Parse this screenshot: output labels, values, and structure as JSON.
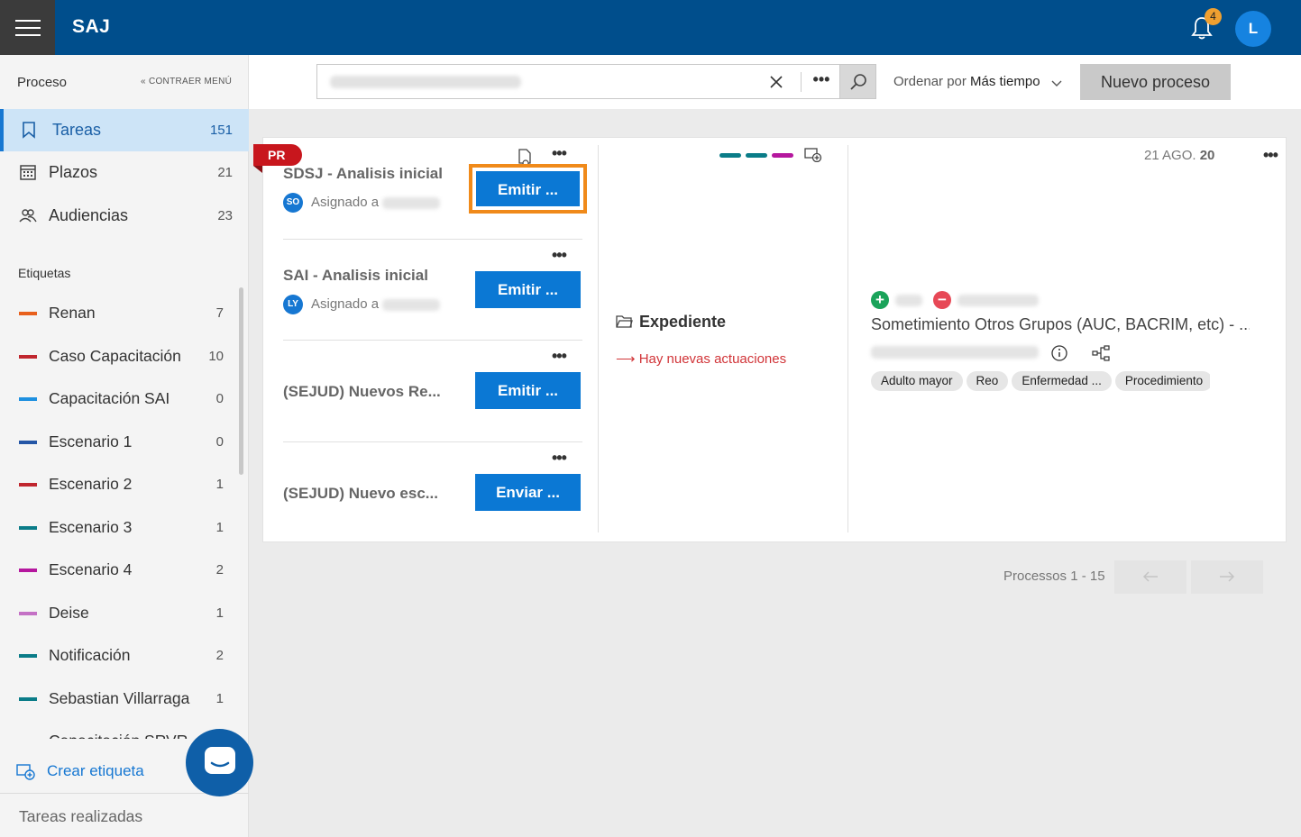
{
  "app": {
    "title": "SAJ",
    "notifications_count": "4",
    "user_initial": "L"
  },
  "sidebar": {
    "header": "Proceso",
    "collapse_label": "CONTRAER MENÚ",
    "nav": [
      {
        "label": "Tareas",
        "count": "151",
        "icon": "bookmark-icon"
      },
      {
        "label": "Plazos",
        "count": "21",
        "icon": "calendar-icon"
      },
      {
        "label": "Audiencias",
        "count": "23",
        "icon": "people-icon"
      }
    ],
    "tags_header": "Etiquetas",
    "tags": [
      {
        "label": "Renan",
        "count": "7",
        "color": "#e8601c"
      },
      {
        "label": "Caso Capacitación",
        "count": "10",
        "color": "#c0262e"
      },
      {
        "label": "Capacitación SAI",
        "count": "0",
        "color": "#1e90e0"
      },
      {
        "label": "Escenario 1",
        "count": "0",
        "color": "#2456a6"
      },
      {
        "label": "Escenario 2",
        "count": "1",
        "color": "#c0262e"
      },
      {
        "label": "Escenario 3",
        "count": "1",
        "color": "#0a7c88"
      },
      {
        "label": "Escenario 4",
        "count": "2",
        "color": "#b5179e"
      },
      {
        "label": "Deise",
        "count": "1",
        "color": "#c471c5"
      },
      {
        "label": "Notificación",
        "count": "2",
        "color": "#0a7c88"
      },
      {
        "label": "Sebastian Villarraga",
        "count": "1",
        "color": "#0a7c88"
      },
      {
        "label": "Capacitación SRVR",
        "count": "",
        "color": "#0a7c88"
      }
    ],
    "create_tag": "Crear etiqueta",
    "done_tasks": "Tareas realizadas"
  },
  "toolbar": {
    "sort_prefix": "Ordenar por",
    "sort_value": "Más tiempo",
    "new_process": "Nuevo proceso"
  },
  "card": {
    "flag": "PR",
    "tasks": [
      {
        "title": "SDSJ - Analisis inicial",
        "assignee_initials": "SO",
        "assigned_label": "Asignado a",
        "button": "Emitir ..."
      },
      {
        "title": "SAI - Analisis inicial",
        "assignee_initials": "LY",
        "assigned_label": "Asignado a",
        "button": "Emitir ..."
      },
      {
        "title": "(SEJUD) Nuevos Re...",
        "button": "Emitir ..."
      },
      {
        "title": "(SEJUD) Nuevo esc...",
        "button": "Enviar ..."
      }
    ],
    "middle": {
      "tag_colors": [
        "#0a7c88",
        "#0a7c88",
        "#b5179e"
      ],
      "expediente": "Expediente",
      "news": "Hay nuevas actuaciones",
      "news_arrow": "⟶"
    },
    "right": {
      "date_prefix": "21 AGO.",
      "date_suffix": "20",
      "process_title": "Sometimiento Otros Grupos (AUC, BACRIM, etc) - ...",
      "chips": [
        "Adulto mayor",
        "Reo",
        "Enfermedad ...",
        "Procedimiento"
      ]
    }
  },
  "pagination": {
    "label": "Processos 1 - 15"
  }
}
